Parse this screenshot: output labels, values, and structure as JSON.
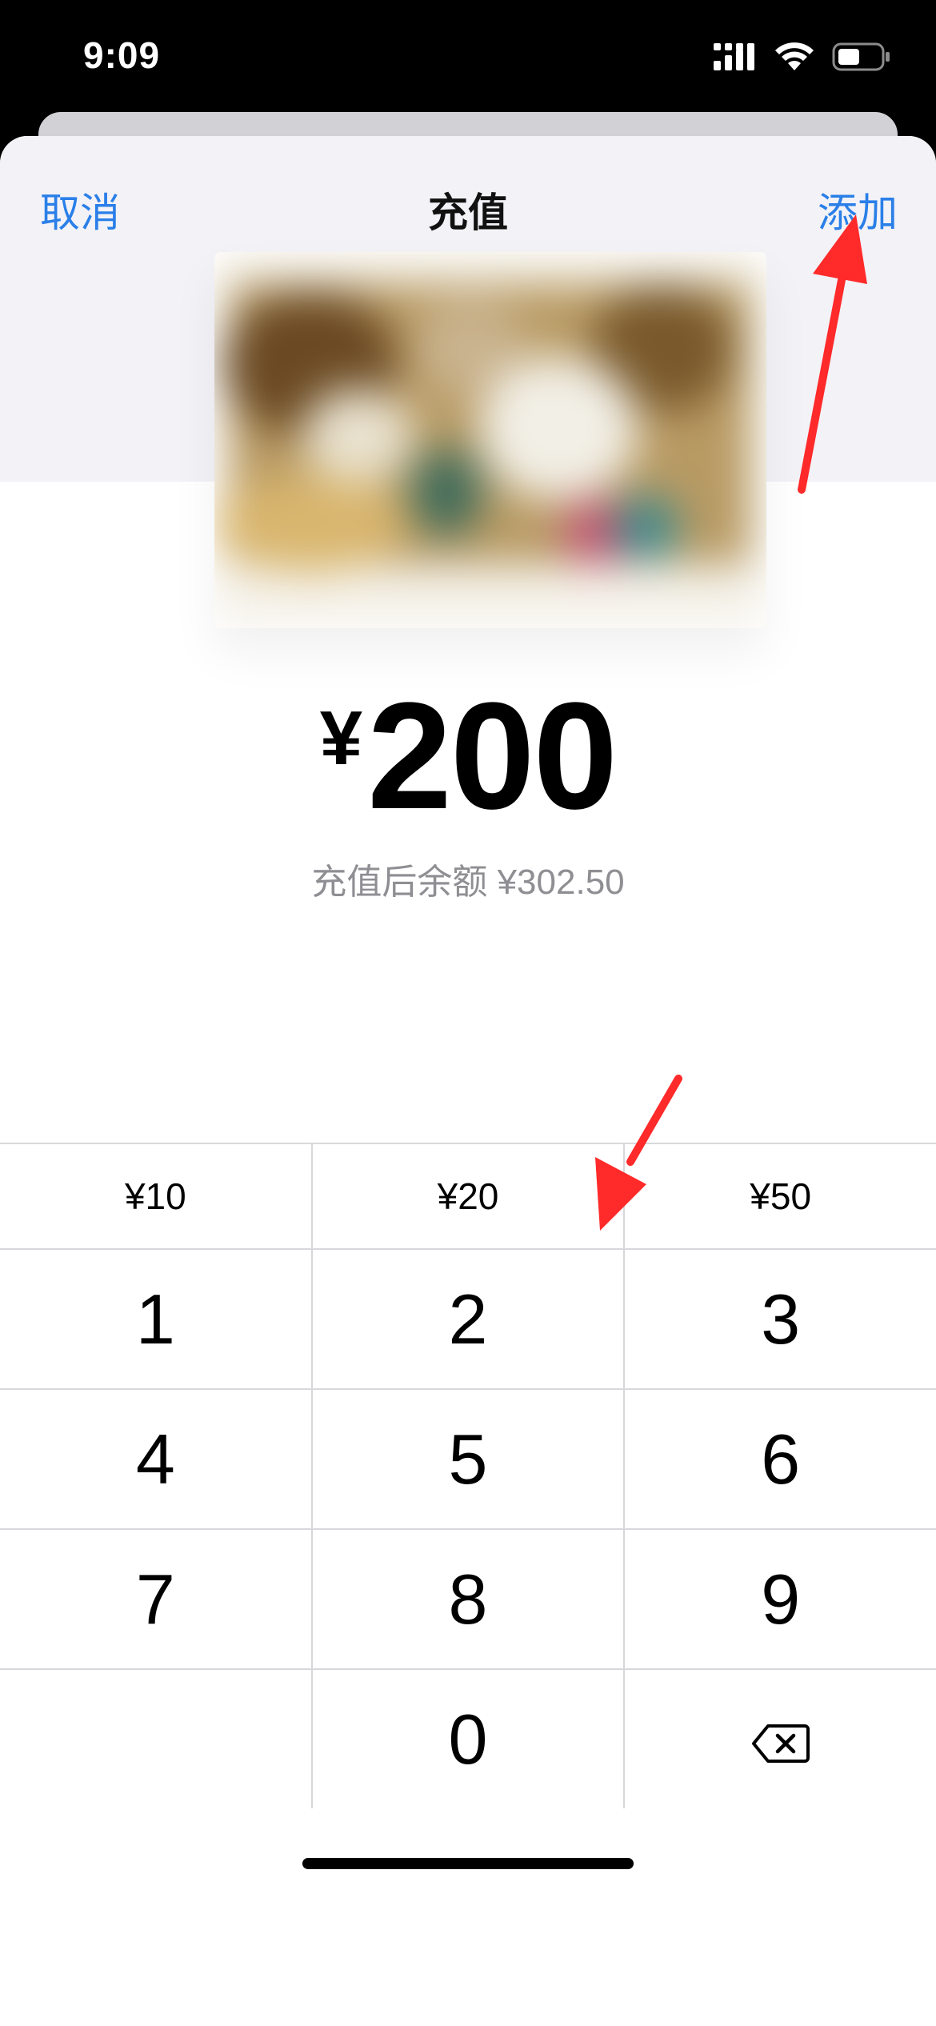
{
  "status_bar": {
    "time": "9:09"
  },
  "nav": {
    "cancel_label": "取消",
    "title": "充值",
    "add_label": "添加"
  },
  "amount": {
    "currency": "¥",
    "value": "200"
  },
  "balance_text": "充值后余额 ¥302.50",
  "quick_amounts": [
    "¥10",
    "¥20",
    "¥50"
  ],
  "keypad": {
    "rows": [
      [
        "1",
        "2",
        "3"
      ],
      [
        "4",
        "5",
        "6"
      ],
      [
        "7",
        "8",
        "9"
      ],
      [
        "",
        "0",
        "backspace"
      ]
    ]
  },
  "colors": {
    "accent": "#2a7fe8",
    "annotation_arrow": "#ff2a2a"
  },
  "icons": [
    "cellular-signal-icon",
    "wifi-icon",
    "battery-icon",
    "backspace-icon"
  ]
}
